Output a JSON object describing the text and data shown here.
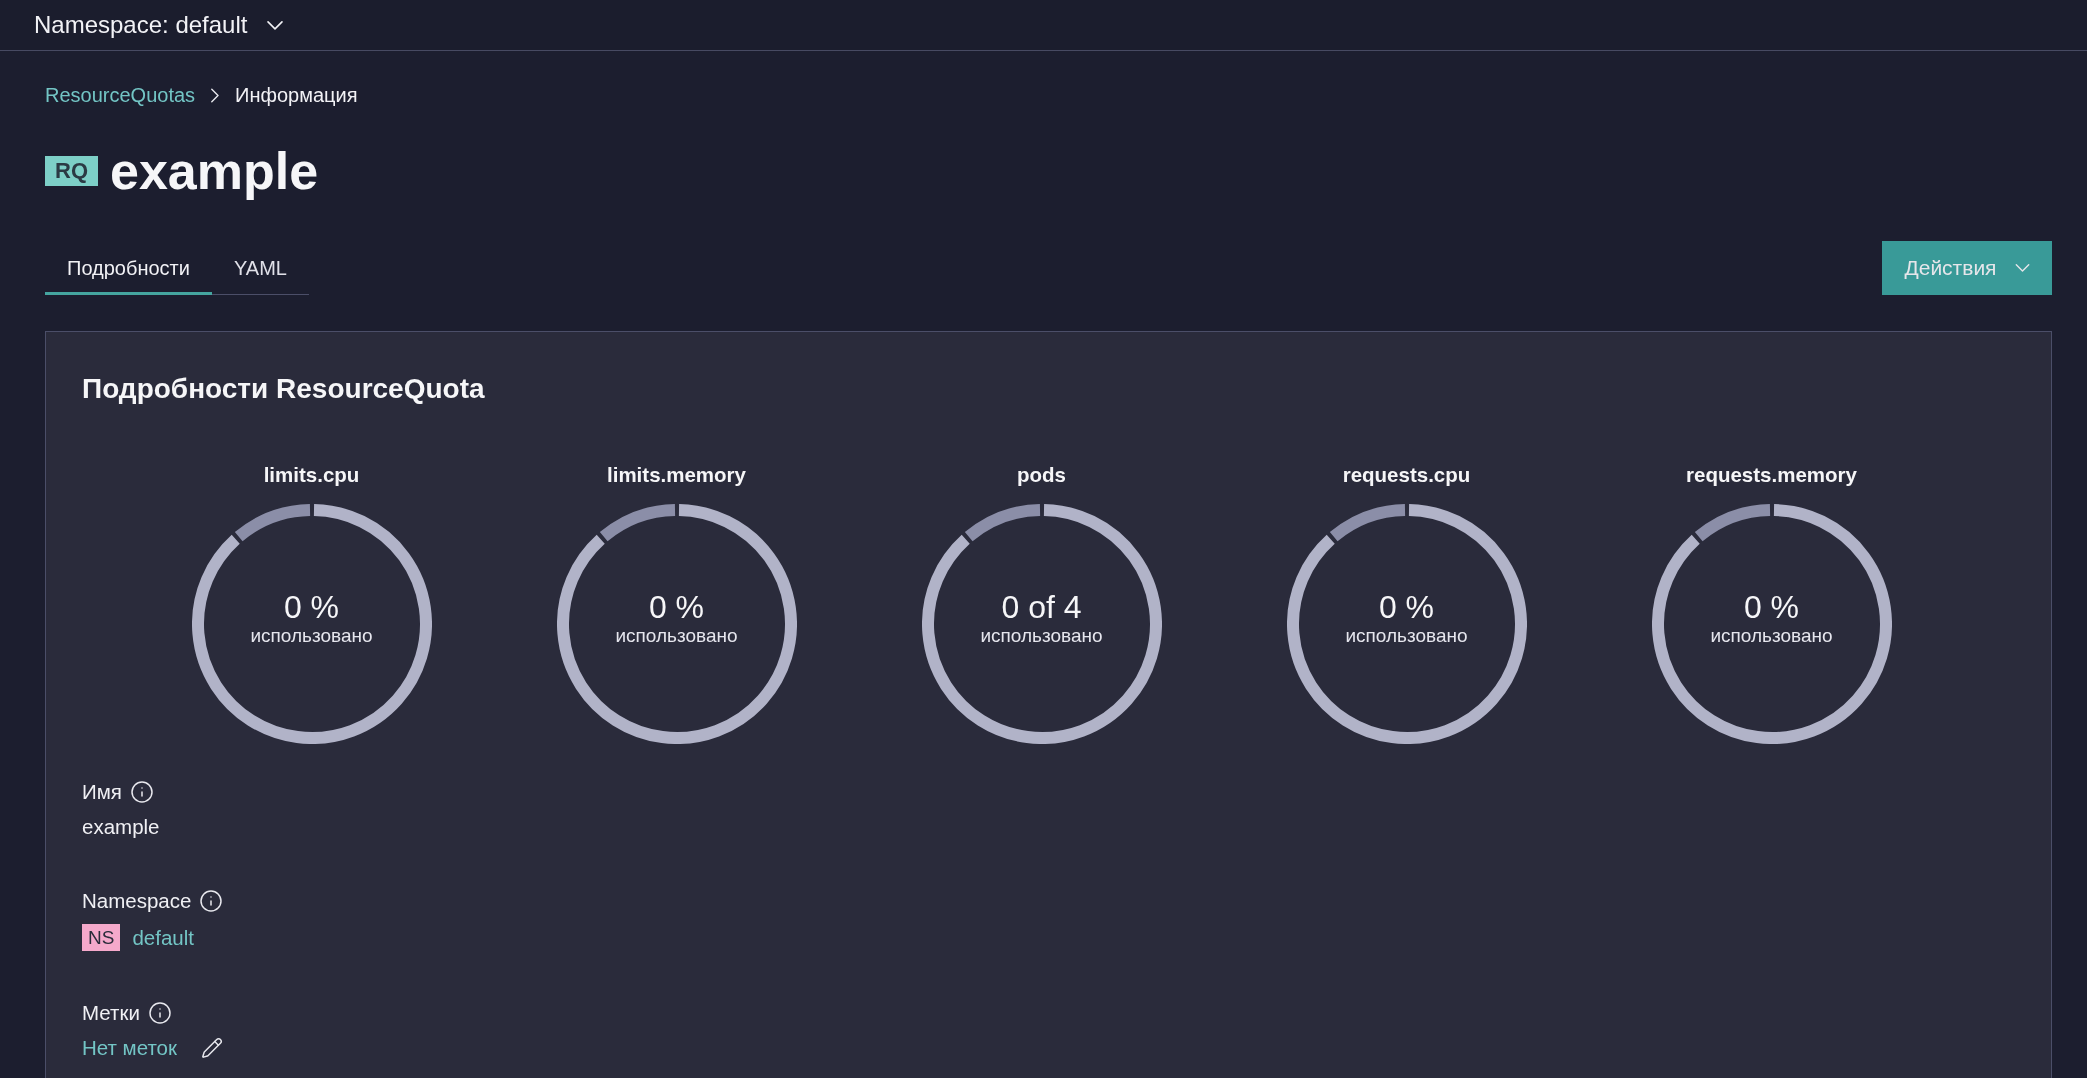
{
  "top_bar": {
    "namespace_selector": "Namespace: default"
  },
  "breadcrumb": {
    "link": "ResourceQuotas",
    "current": "Информация"
  },
  "title": {
    "badge": "RQ",
    "name": "example"
  },
  "tabs": [
    {
      "label": "Подробности",
      "selected": true
    },
    {
      "label": "YAML",
      "selected": false
    }
  ],
  "actions_button": {
    "label": "Действия"
  },
  "details_panel": {
    "heading": "Подробности ResourceQuota",
    "quotas": [
      {
        "name": "limits.cpu",
        "value": "0 %",
        "caption": "использовано"
      },
      {
        "name": "limits.memory",
        "value": "0 %",
        "caption": "использовано"
      },
      {
        "name": "pods",
        "value": "0 of 4",
        "caption": "использовано"
      },
      {
        "name": "requests.cpu",
        "value": "0 %",
        "caption": "использовано"
      },
      {
        "name": "requests.memory",
        "value": "0 %",
        "caption": "использовано"
      }
    ],
    "fields": [
      {
        "label": "Имя",
        "kind": "text",
        "value": "example"
      },
      {
        "label": "Namespace",
        "kind": "namespace",
        "badge": "NS",
        "value": "default"
      },
      {
        "label": "Метки",
        "kind": "labels",
        "value": "Нет меток"
      }
    ]
  }
}
